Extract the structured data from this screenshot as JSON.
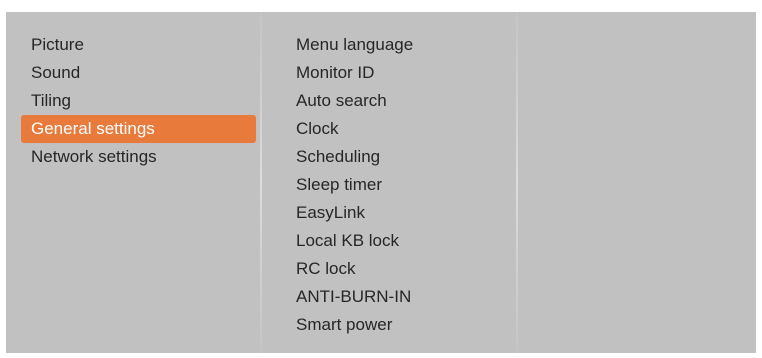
{
  "main_menu": {
    "items": [
      {
        "label": "Picture"
      },
      {
        "label": "Sound"
      },
      {
        "label": "Tiling"
      },
      {
        "label": "General settings"
      },
      {
        "label": "Network settings"
      }
    ],
    "selected_index": 3
  },
  "submenu": {
    "items": [
      {
        "label": "Menu language"
      },
      {
        "label": "Monitor ID"
      },
      {
        "label": "Auto search"
      },
      {
        "label": "Clock"
      },
      {
        "label": "Scheduling"
      },
      {
        "label": "Sleep timer"
      },
      {
        "label": "EasyLink"
      },
      {
        "label": "Local KB lock"
      },
      {
        "label": "RC lock"
      },
      {
        "label": "ANTI-BURN-IN"
      },
      {
        "label": "Smart power"
      }
    ]
  },
  "colors": {
    "panel_background": "#c1c1c2",
    "highlight": "#e87a3b",
    "text": "#262626",
    "highlight_text": "#ffffff"
  }
}
